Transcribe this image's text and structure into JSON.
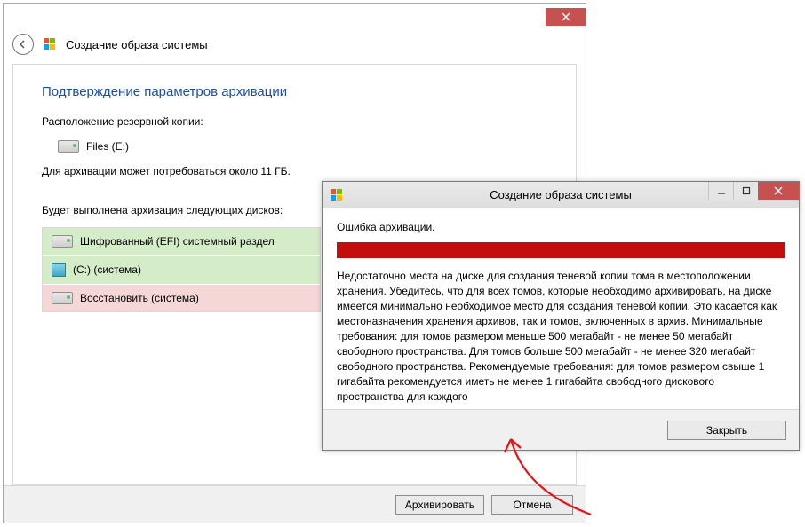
{
  "wizard": {
    "window_title": "Создание образа системы",
    "section_title": "Подтверждение параметров архивации",
    "location_label": "Расположение резервной копии:",
    "location_value": "Files (E:)",
    "estimate": "Для архивации может потребоваться около 11 ГБ.",
    "disks_label": "Будет выполнена архивация следующих дисков:",
    "disks": [
      {
        "name": "Шифрованный (EFI) системный раздел"
      },
      {
        "name": "(C:) (система)"
      },
      {
        "name": "Восстановить (система)"
      }
    ],
    "buttons": {
      "archive": "Архивировать",
      "cancel": "Отмена"
    }
  },
  "error_dialog": {
    "window_title": "Создание образа системы",
    "heading": "Ошибка архивации.",
    "message": "Недостаточно места на диске для создания теневой копии тома в местоположении хранения. Убедитесь, что для всех томов, которые необходимо архивировать, на диске имеется минимально необходимое место для создания теневой копии. Это касается как местоназначения хранения архивов, так и томов, включенных в архив. Минимальные требования: для томов размером меньше 500 мегабайт - не менее 50 мегабайт свободного пространства. Для томов больше 500 мегабайт - не менее 320 мегабайт свободного пространства. Рекомендуемые требования: для томов размером свыше 1 гигабайта рекомендуется иметь не менее 1 гигабайта свободного дискового пространства для каждого",
    "close_button": "Закрыть"
  }
}
